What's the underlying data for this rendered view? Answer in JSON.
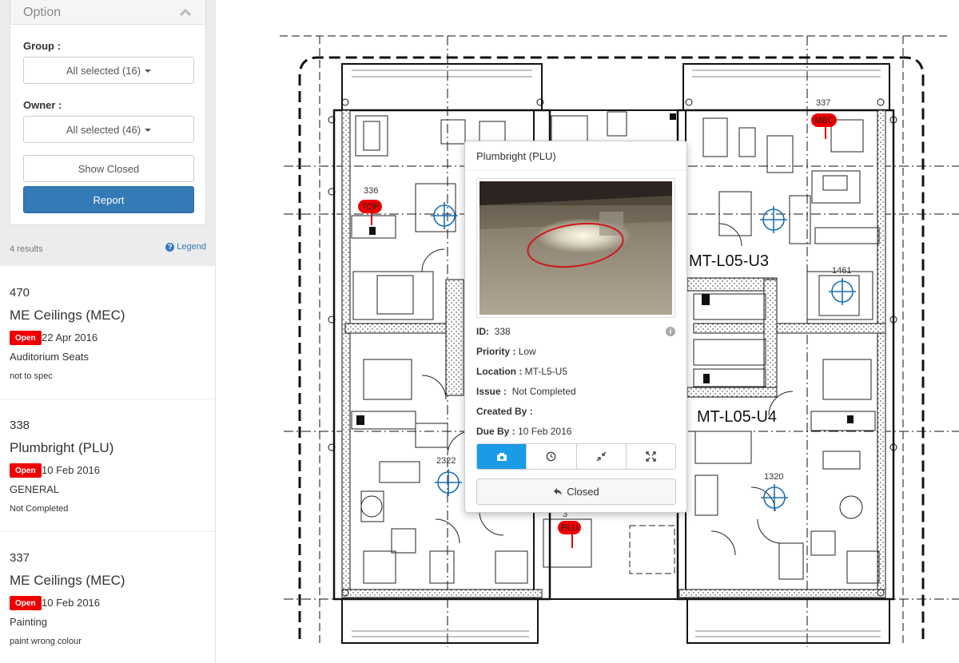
{
  "sidebar": {
    "option_title": "Option",
    "group_label": "Group :",
    "group_value": "All selected (16)",
    "owner_label": "Owner :",
    "owner_value": "All selected (46)",
    "show_closed_label": "Show Closed",
    "report_label": "Report",
    "results_count": "4  results",
    "legend_label": "Legend"
  },
  "results": [
    {
      "id": "470",
      "name": "ME Ceilings (MEC)",
      "status": "Open",
      "date": "22 Apr 2016",
      "category": "Auditorium Seats",
      "description": "not to spec"
    },
    {
      "id": "338",
      "name": "Plumbright (PLU)",
      "status": "Open",
      "date": "10 Feb 2016",
      "category": "GENERAL",
      "description": "Not Completed"
    },
    {
      "id": "337",
      "name": "ME Ceilings (MEC)",
      "status": "Open",
      "date": "10 Feb 2016",
      "category": "Painting",
      "description": "paint wrong colour"
    }
  ],
  "plan": {
    "units": [
      "MT-L05-U3",
      "MT-L05-U4"
    ],
    "pins": {
      "p336": {
        "number": "336",
        "tag": "TOP"
      },
      "p337": {
        "number": "337",
        "tag": "MEC"
      },
      "p1461": {
        "number": "1461"
      },
      "p2322": {
        "number": "2322"
      },
      "p1320": {
        "number": "1320"
      },
      "p338": {
        "number": "3",
        "tag": "PLU"
      }
    },
    "colors": {
      "pin": "#e00000",
      "target": "#1b6fb5"
    }
  },
  "popup": {
    "title": "Plumbright (PLU)",
    "id_label": "ID:",
    "id_value": "338",
    "priority_label": "Priority :",
    "priority_value": "Low",
    "location_label": "Location :",
    "location_value": "MT-L5-U5",
    "issue_label": "Issue :",
    "issue_value": "Not Completed",
    "created_label": "Created By :",
    "created_value": "",
    "due_label": "Due By :",
    "due_value": "10 Feb 2016",
    "tabs": [
      "camera-icon",
      "clock-icon",
      "compress-icon",
      "expand-icon"
    ],
    "closed_label": "Closed"
  },
  "colors": {
    "primary": "#337ab7",
    "open_badge": "#ee0000",
    "active_tab": "#1a9be8"
  }
}
